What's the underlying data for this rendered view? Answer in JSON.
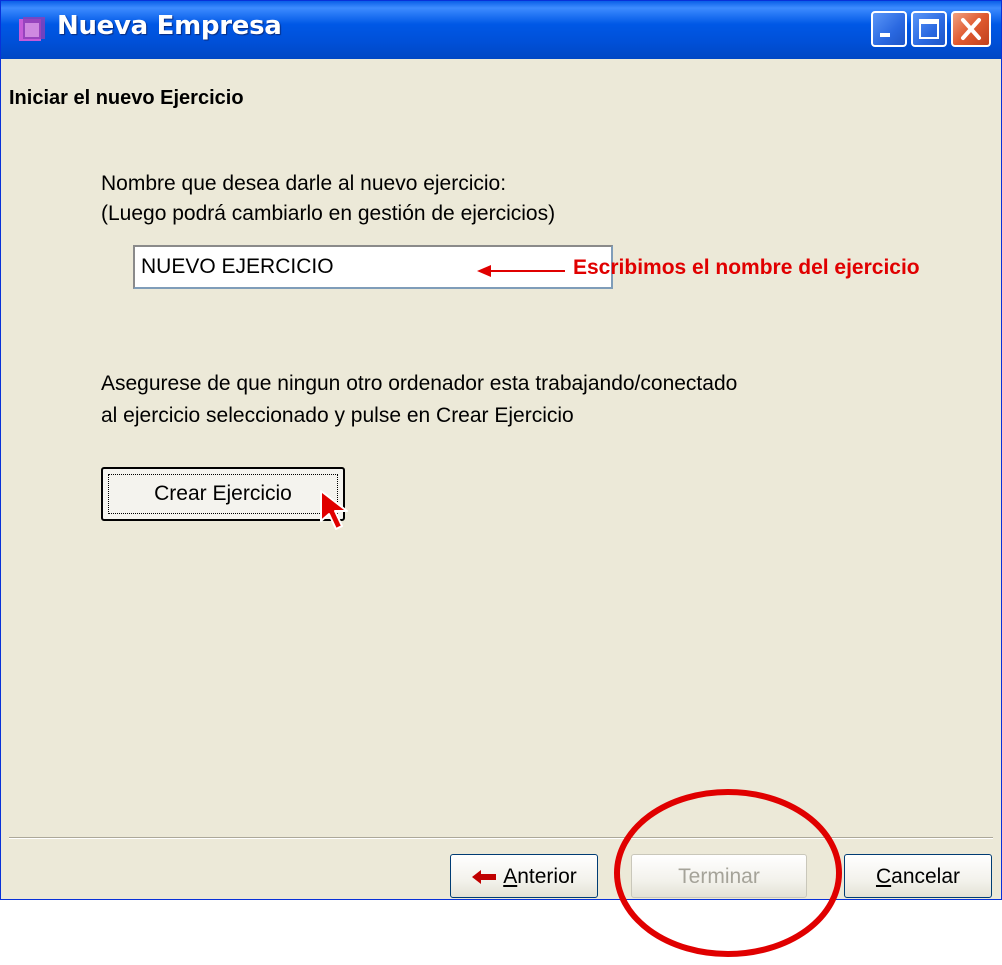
{
  "window": {
    "title": "Nueva Empresa",
    "icon": "app-icon",
    "controls": [
      "minimize-icon",
      "maximize-icon",
      "close-icon"
    ]
  },
  "wizard": {
    "header": "Iniciar el nuevo Ejercicio",
    "name_prompt_line1": "Nombre que desea darle al nuevo ejercicio:",
    "name_prompt_line2": "(Luego podrá cambiarlo en gestión de ejercicios)",
    "name_value": "NUEVO EJERCICIO",
    "warning_line1": "Asegurese de que ningun otro ordenador esta trabajando/conectado",
    "warning_line2": "al ejercicio seleccionado y pulse en Crear Ejercicio",
    "create_button": "Crear Ejercicio"
  },
  "annotation": {
    "text": "Escribimos el nombre del ejercicio",
    "color": "#e00000"
  },
  "footer": {
    "anterior_first": "A",
    "anterior_rest": "nterior",
    "terminar": "Terminar",
    "cancelar_first": "C",
    "cancelar_rest": "ancelar"
  },
  "colors": {
    "titlebar": "#0058e6",
    "dialog_bg": "#ece9d8",
    "highlight_circle": "#e00000"
  }
}
